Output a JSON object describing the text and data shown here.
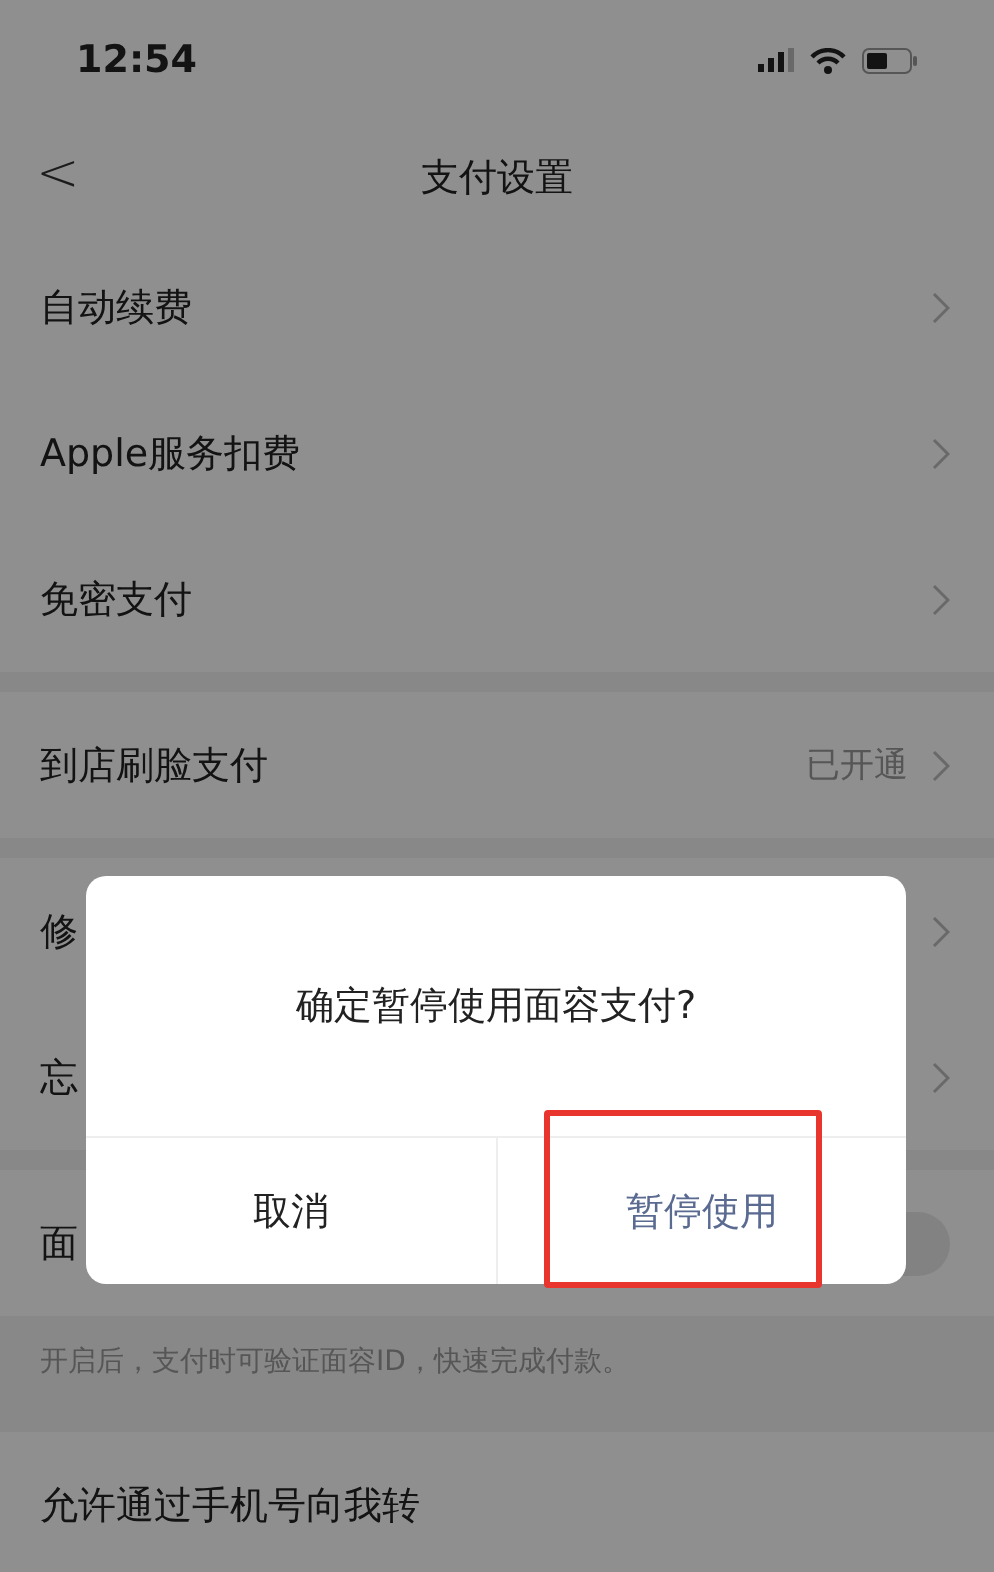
{
  "status_bar": {
    "time": "12:54"
  },
  "nav": {
    "back": "<",
    "title": "支付设置"
  },
  "groups": [
    {
      "kind": "list",
      "rows": [
        {
          "label": "自动续费"
        },
        {
          "label": "Apple服务扣费"
        },
        {
          "label": "免密支付"
        }
      ]
    },
    {
      "kind": "list",
      "rows": [
        {
          "label": "到店刷脸支付",
          "value": "已开通"
        }
      ]
    },
    {
      "kind": "list",
      "rows": [
        {
          "label": "修"
        },
        {
          "label": "忘"
        }
      ]
    },
    {
      "kind": "toggle",
      "rows": [
        {
          "label": "面",
          "on": false
        }
      ],
      "hint": "开启后，支付时可验证面容ID，快速完成付款。"
    },
    {
      "kind": "list",
      "rows": [
        {
          "label": "允许通过手机号向我转"
        }
      ],
      "chevron": false
    }
  ],
  "dialog": {
    "message": "确定暂停使用面容支付?",
    "buttons": [
      {
        "label": "取消",
        "kind": "cancel",
        "highlighted": false
      },
      {
        "label": "暂停使用",
        "kind": "confirm",
        "highlighted": true
      }
    ]
  }
}
